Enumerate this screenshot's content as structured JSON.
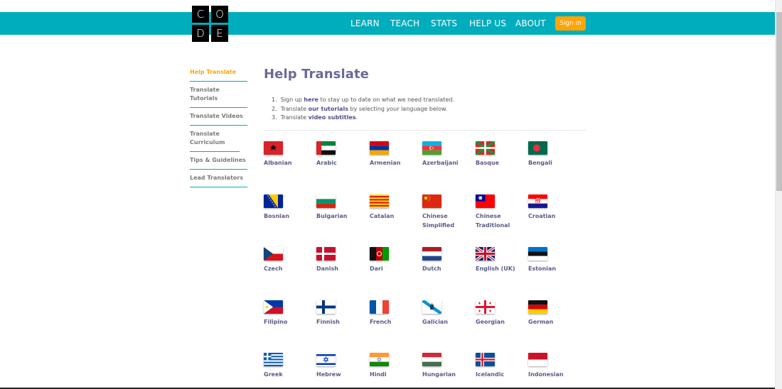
{
  "logo": {
    "letters": [
      "C",
      "O",
      "D",
      "E"
    ]
  },
  "nav": {
    "items": [
      "LEARN",
      "TEACH",
      "STATS",
      "HELP US",
      "ABOUT"
    ],
    "signin": "Sign in"
  },
  "sidebar": {
    "items": [
      "Help Translate",
      "Translate Tutorials",
      "Translate Videos",
      "Translate Curriculum",
      "Tips & Guidelines",
      "Lead Translators"
    ]
  },
  "main": {
    "title": "Help Translate",
    "steps": [
      {
        "num": "1.",
        "pre": "Sign up ",
        "link": "here",
        "post": " to stay up to date on what we need translated."
      },
      {
        "num": "2.",
        "pre": "Translate ",
        "link": "our tutorials",
        "post": " by selecting your language below."
      },
      {
        "num": "3.",
        "pre": "Translate ",
        "link": "video subtitles",
        "post": "."
      }
    ]
  },
  "languages": [
    {
      "name": "Albanian",
      "flag": "albania-flag-icon"
    },
    {
      "name": "Arabic",
      "flag": "uae-flag-icon"
    },
    {
      "name": "Armenian",
      "flag": "armenia-flag-icon"
    },
    {
      "name": "Azerbaijani",
      "flag": "azerbaijan-flag-icon"
    },
    {
      "name": "Basque",
      "flag": "basque-flag-icon"
    },
    {
      "name": "Bengali",
      "flag": "bangladesh-flag-icon"
    },
    {
      "name": "Bosnian",
      "flag": "bosnia-flag-icon"
    },
    {
      "name": "Bulgarian",
      "flag": "bulgaria-flag-icon"
    },
    {
      "name": "Catalan",
      "flag": "catalonia-flag-icon"
    },
    {
      "name": "Chinese Simplified",
      "flag": "china-flag-icon"
    },
    {
      "name": "Chinese Traditional",
      "flag": "taiwan-flag-icon"
    },
    {
      "name": "Croatian",
      "flag": "croatia-flag-icon"
    },
    {
      "name": "Czech",
      "flag": "czech-flag-icon"
    },
    {
      "name": "Danish",
      "flag": "denmark-flag-icon"
    },
    {
      "name": "Dari",
      "flag": "afghanistan-flag-icon"
    },
    {
      "name": "Dutch",
      "flag": "netherlands-flag-icon"
    },
    {
      "name": "English (UK)",
      "flag": "uk-flag-icon"
    },
    {
      "name": "Estonian",
      "flag": "estonia-flag-icon"
    },
    {
      "name": "Filipino",
      "flag": "philippines-flag-icon"
    },
    {
      "name": "Finnish",
      "flag": "finland-flag-icon"
    },
    {
      "name": "French",
      "flag": "france-flag-icon"
    },
    {
      "name": "Galician",
      "flag": "galicia-flag-icon"
    },
    {
      "name": "Georgian",
      "flag": "georgia-flag-icon"
    },
    {
      "name": "German",
      "flag": "germany-flag-icon"
    },
    {
      "name": "Greek",
      "flag": "greece-flag-icon"
    },
    {
      "name": "Hebrew",
      "flag": "israel-flag-icon"
    },
    {
      "name": "Hindi",
      "flag": "india-flag-icon"
    },
    {
      "name": "Hungarian",
      "flag": "hungary-flag-icon"
    },
    {
      "name": "Icelandic",
      "flag": "iceland-flag-icon"
    },
    {
      "name": "Indonesian",
      "flag": "indonesia-flag-icon"
    }
  ],
  "colors": {
    "header": "#00adbc",
    "signin": "#ffa400",
    "active": "#ffa400",
    "title": "#6a6a99",
    "link": "#5b5b8a"
  }
}
